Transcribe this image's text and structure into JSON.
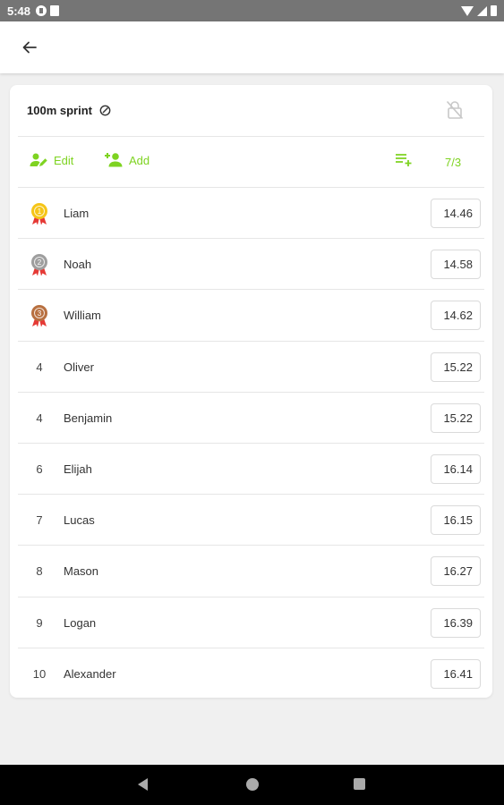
{
  "status_bar": {
    "time": "5:48"
  },
  "event": {
    "title": "100m sprint"
  },
  "toolbar": {
    "edit_label": "Edit",
    "add_label": "Add",
    "count": "7/3"
  },
  "colors": {
    "accent": "#7ed321",
    "gold": "#f5c518",
    "silver": "#9e9e9e",
    "bronze": "#b87040"
  },
  "results": [
    {
      "rank": "1",
      "medal": "gold",
      "name": "Liam",
      "time": "14.46"
    },
    {
      "rank": "2",
      "medal": "silver",
      "name": "Noah",
      "time": "14.58"
    },
    {
      "rank": "3",
      "medal": "bronze",
      "name": "William",
      "time": "14.62"
    },
    {
      "rank": "4",
      "medal": "",
      "name": "Oliver",
      "time": "15.22"
    },
    {
      "rank": "4",
      "medal": "",
      "name": "Benjamin",
      "time": "15.22"
    },
    {
      "rank": "6",
      "medal": "",
      "name": "Elijah",
      "time": "16.14"
    },
    {
      "rank": "7",
      "medal": "",
      "name": "Lucas",
      "time": "16.15"
    },
    {
      "rank": "8",
      "medal": "",
      "name": "Mason",
      "time": "16.27"
    },
    {
      "rank": "9",
      "medal": "",
      "name": "Logan",
      "time": "16.39"
    },
    {
      "rank": "10",
      "medal": "",
      "name": "Alexander",
      "time": "16.41"
    }
  ]
}
